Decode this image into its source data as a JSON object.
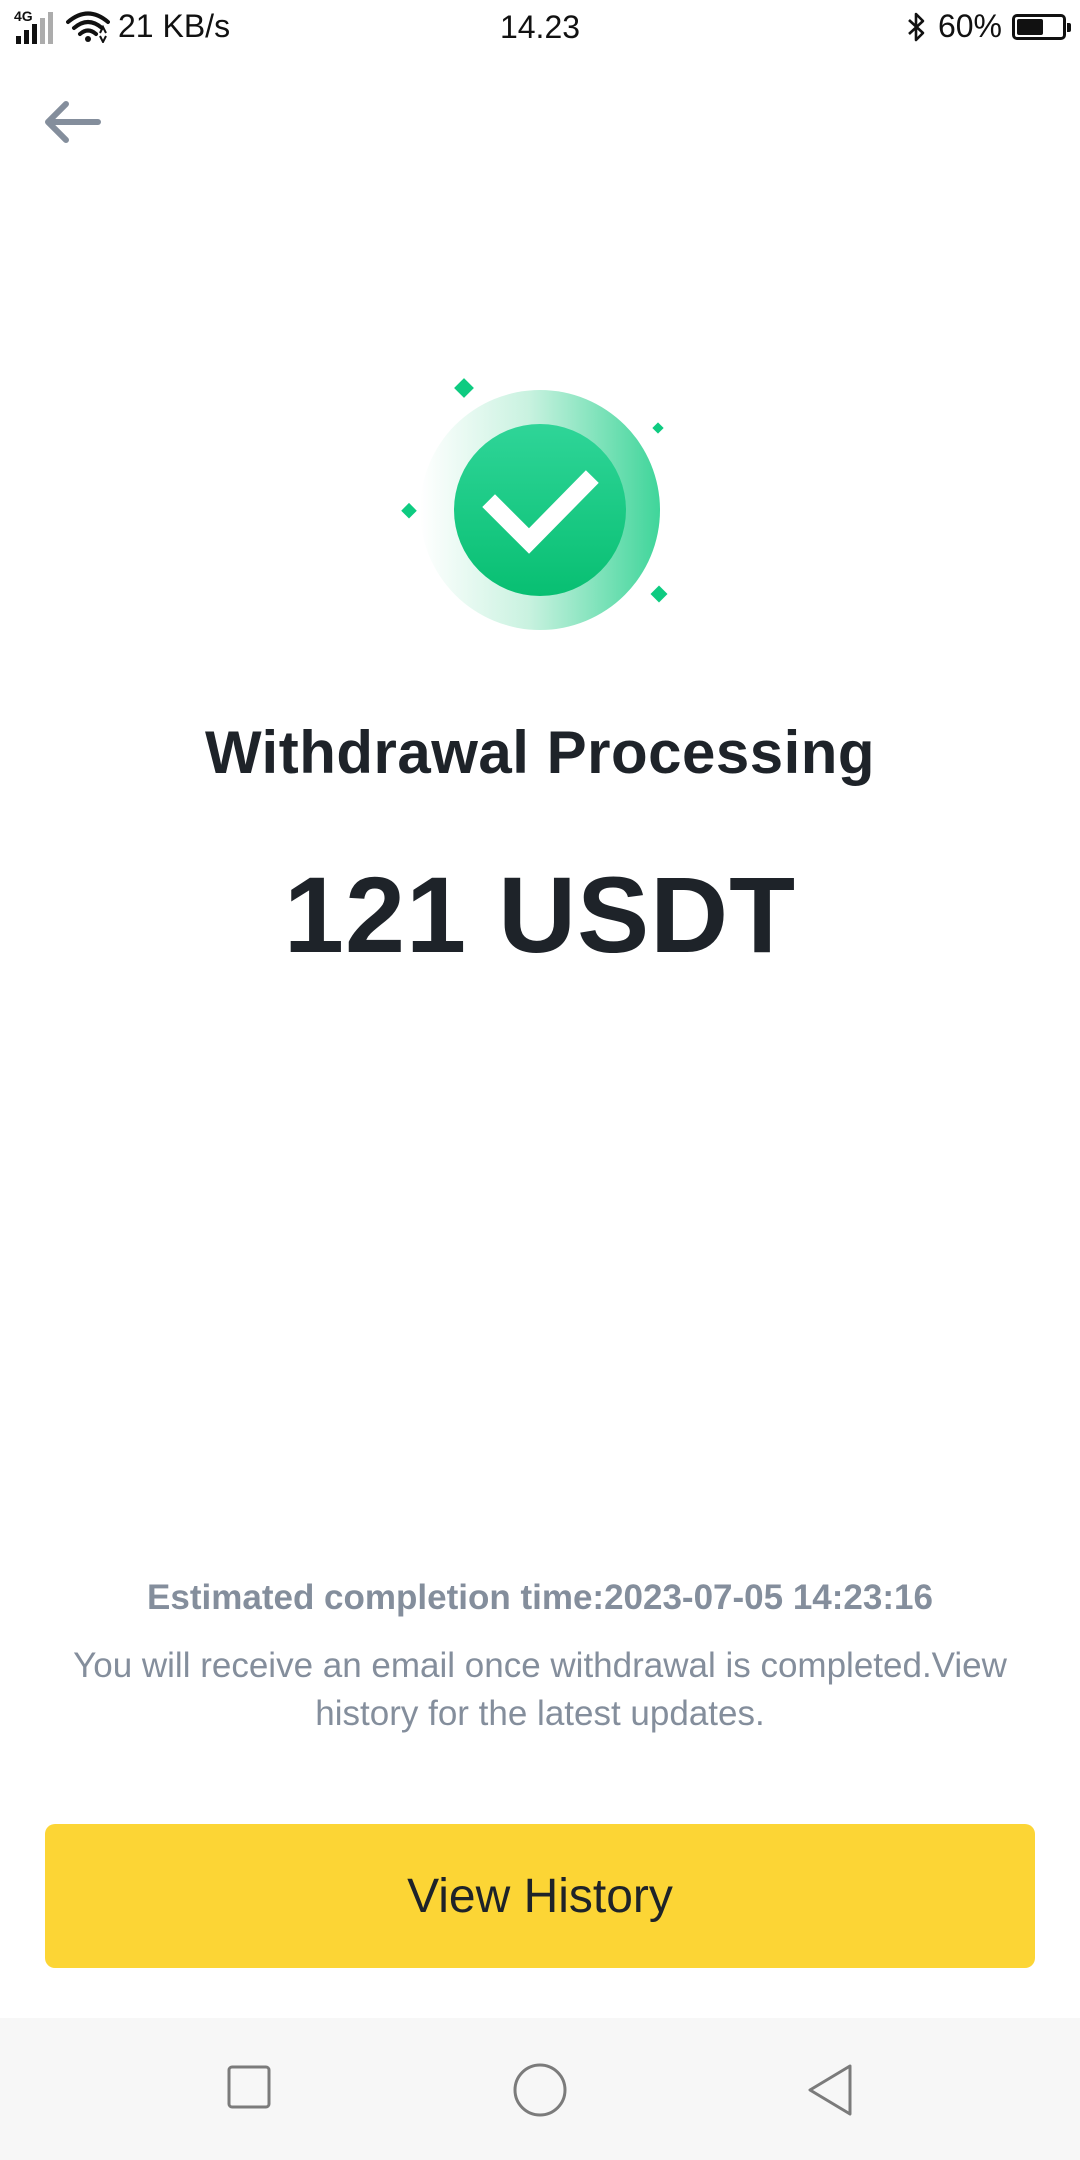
{
  "status_bar": {
    "network_type": "4G",
    "speed": "21 KB/s",
    "time": "14.23",
    "battery_percent": "60%",
    "battery_level": 0.6
  },
  "icons": {
    "back": "arrow-left-icon",
    "success": "checkmark-success-icon",
    "bluetooth": "bluetooth-icon",
    "wifi": "wifi-icon",
    "signal": "signal-icon",
    "battery": "battery-icon"
  },
  "main": {
    "title": "Withdrawal Processing",
    "amount": "121 USDT",
    "estimated_completion": "Estimated completion time:2023-07-05 14:23:16",
    "note": "You will receive an email once withdrawal is completed.View history for the latest updates."
  },
  "actions": {
    "view_history_label": "View History"
  },
  "colors": {
    "accent_yellow": "#fcd535",
    "success_green": "#0ecb81",
    "text_primary": "#1e2329",
    "text_secondary": "#848e9c"
  },
  "system_nav": [
    "recent-apps",
    "home",
    "back"
  ]
}
